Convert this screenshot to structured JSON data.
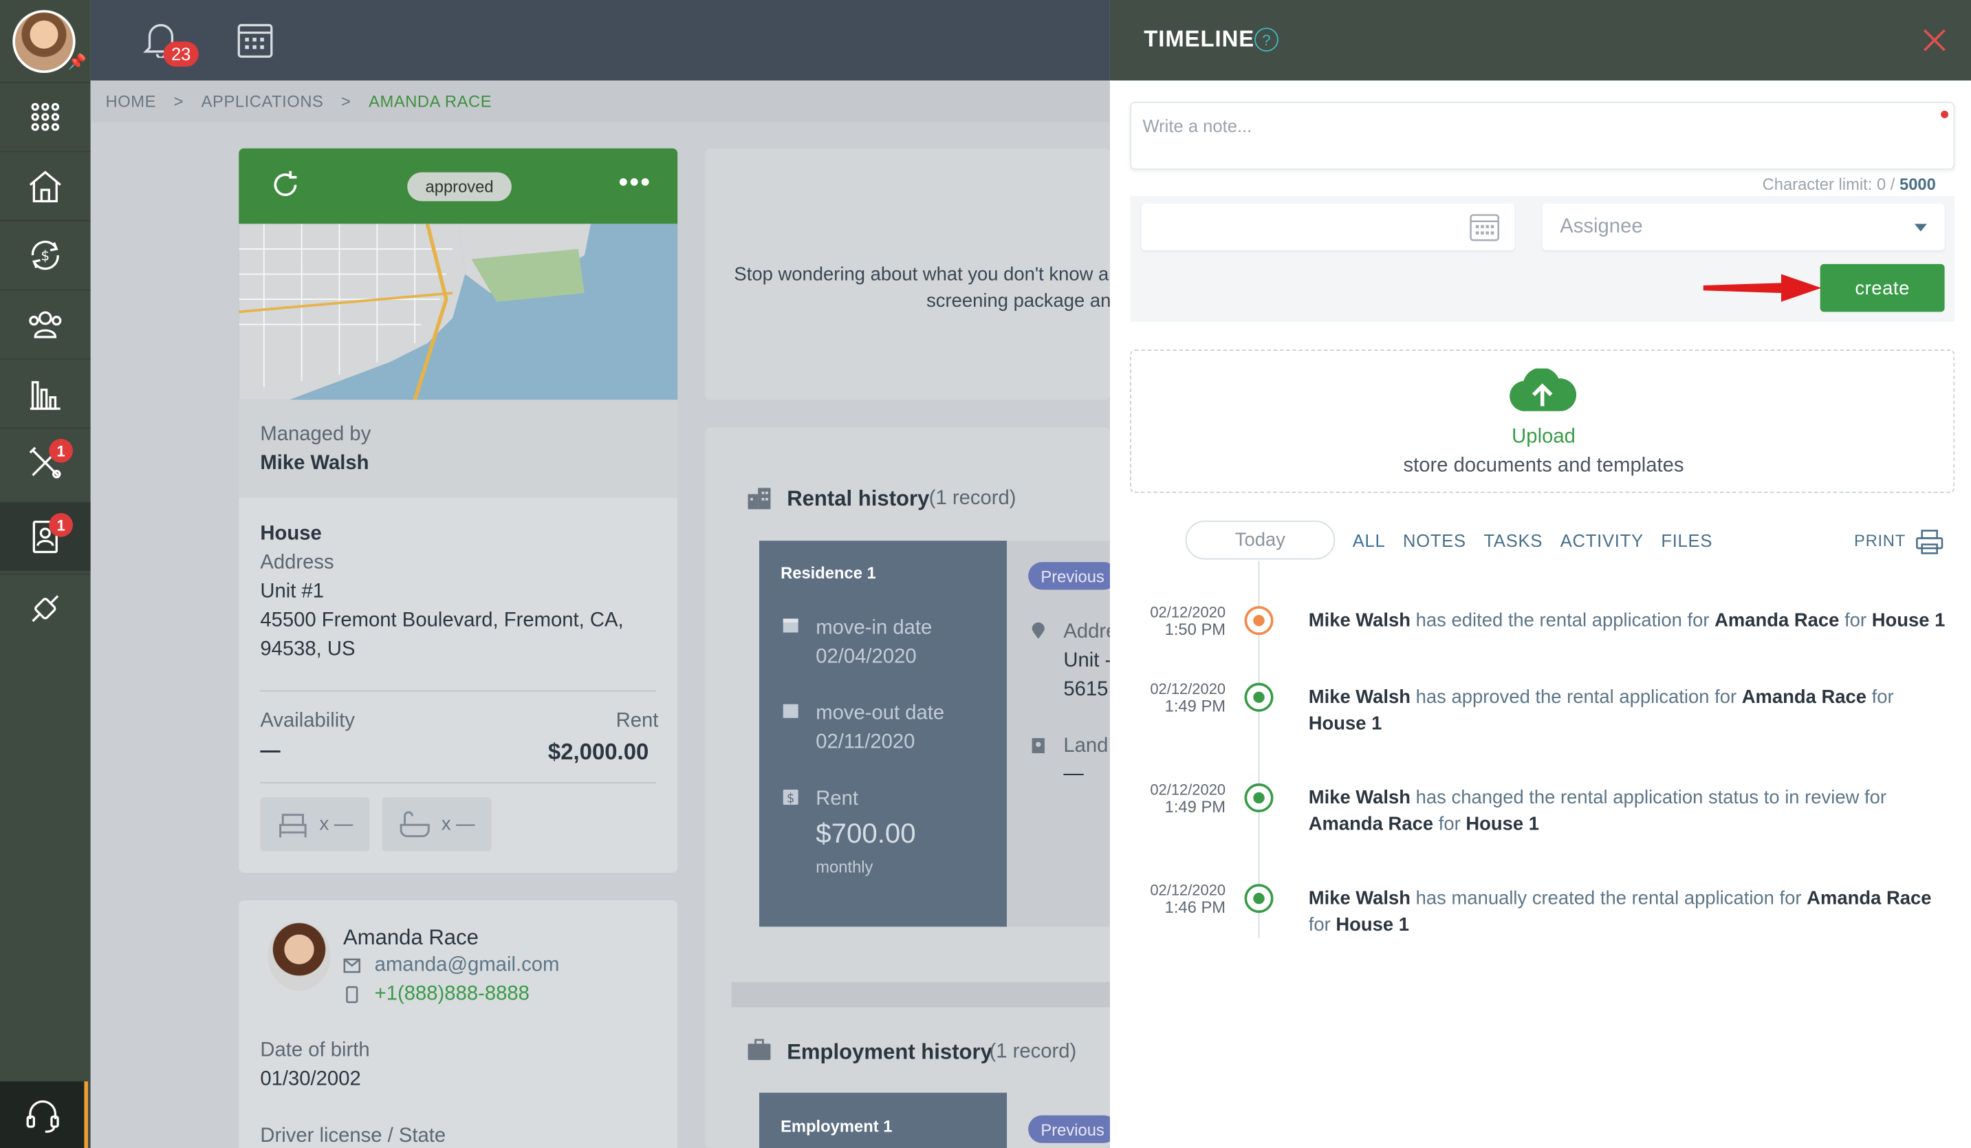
{
  "topbar": {
    "notifications_count": "23"
  },
  "breadcrumb": {
    "home": "HOME",
    "applications": "APPLICATIONS",
    "current": "AMANDA RACE",
    "sep": ">"
  },
  "sidebar": {
    "badge_maintenance": "1",
    "badge_applications": "1"
  },
  "property": {
    "status": "approved",
    "managed_by_label": "Managed by",
    "manager": "Mike Walsh",
    "type": "House",
    "address_label": "Address",
    "unit": "Unit #1",
    "address_line1": "45500 Fremont Boulevard, Fremont, CA,",
    "address_line2": "94538, US",
    "availability_label": "Availability",
    "availability_value": "—",
    "rent_label": "Rent",
    "rent_value": "$2,000.00",
    "beds": "x —",
    "baths": "x —"
  },
  "tenant": {
    "name": "Amanda Race",
    "email": "amanda@gmail.com",
    "phone": "+1(888)888-8888",
    "dob_label": "Date of birth",
    "dob": "01/30/2002",
    "license_label": "Driver license / State"
  },
  "promo": {
    "line1": "Stop wondering about what you don't know a",
    "line2": "screening package an"
  },
  "rental_history": {
    "title": "Rental history",
    "count": "(1 record)",
    "residence_label": "Residence 1",
    "move_in_label": "move-in date",
    "move_in": "02/04/2020",
    "move_out_label": "move-out date",
    "move_out": "02/11/2020",
    "rent_label": "Rent",
    "rent_value": "$700.00",
    "rent_period": "monthly",
    "previous_pill": "Previous",
    "address_label": "Addre",
    "unit_partial": "Unit -",
    "number_partial": "5615",
    "landlord_label": "Land",
    "landlord_value": "—"
  },
  "employment_history": {
    "title": "Employment history",
    "count": "(1 record)",
    "employment_label": "Employment 1",
    "previous_pill": "Previous"
  },
  "timeline": {
    "title": "TIMELINE",
    "help": "?",
    "note_placeholder": "Write a note...",
    "char_limit_label": "Character limit: 0 /",
    "char_limit_max": "5000",
    "assignee_placeholder": "Assignee",
    "create_label": "create",
    "upload_title": "Upload",
    "upload_subtitle": "store documents and templates",
    "tabs": {
      "today": "Today",
      "all": "ALL",
      "notes": "NOTES",
      "tasks": "TASKS",
      "activity": "ACTIVITY",
      "files": "FILES"
    },
    "print_label": "PRINT",
    "entries": [
      {
        "date": "02/12/2020",
        "time": "1:50 PM",
        "actor": "Mike Walsh",
        "action": "has edited the rental application for",
        "subject": "Amanda Race",
        "for": "for",
        "target": "House 1"
      },
      {
        "date": "02/12/2020",
        "time": "1:49 PM",
        "actor": "Mike Walsh",
        "action": "has approved the rental application for",
        "subject": "Amanda Race",
        "for": "for",
        "target": "House 1"
      },
      {
        "date": "02/12/2020",
        "time": "1:49 PM",
        "actor": "Mike Walsh",
        "action": "has changed the rental application status to in review for",
        "subject": "Amanda Race",
        "for": "for",
        "target": "House 1"
      },
      {
        "date": "02/12/2020",
        "time": "1:46 PM",
        "actor": "Mike Walsh",
        "action": "has manually created the rental application for",
        "subject": "Amanda Race",
        "for": "for",
        "target": "House 1"
      }
    ]
  },
  "colors": {
    "brand_green": "#3a9a48",
    "sidebar": "#3f4a41",
    "panel_header": "#424e46",
    "alert_red": "#e03b3b"
  }
}
